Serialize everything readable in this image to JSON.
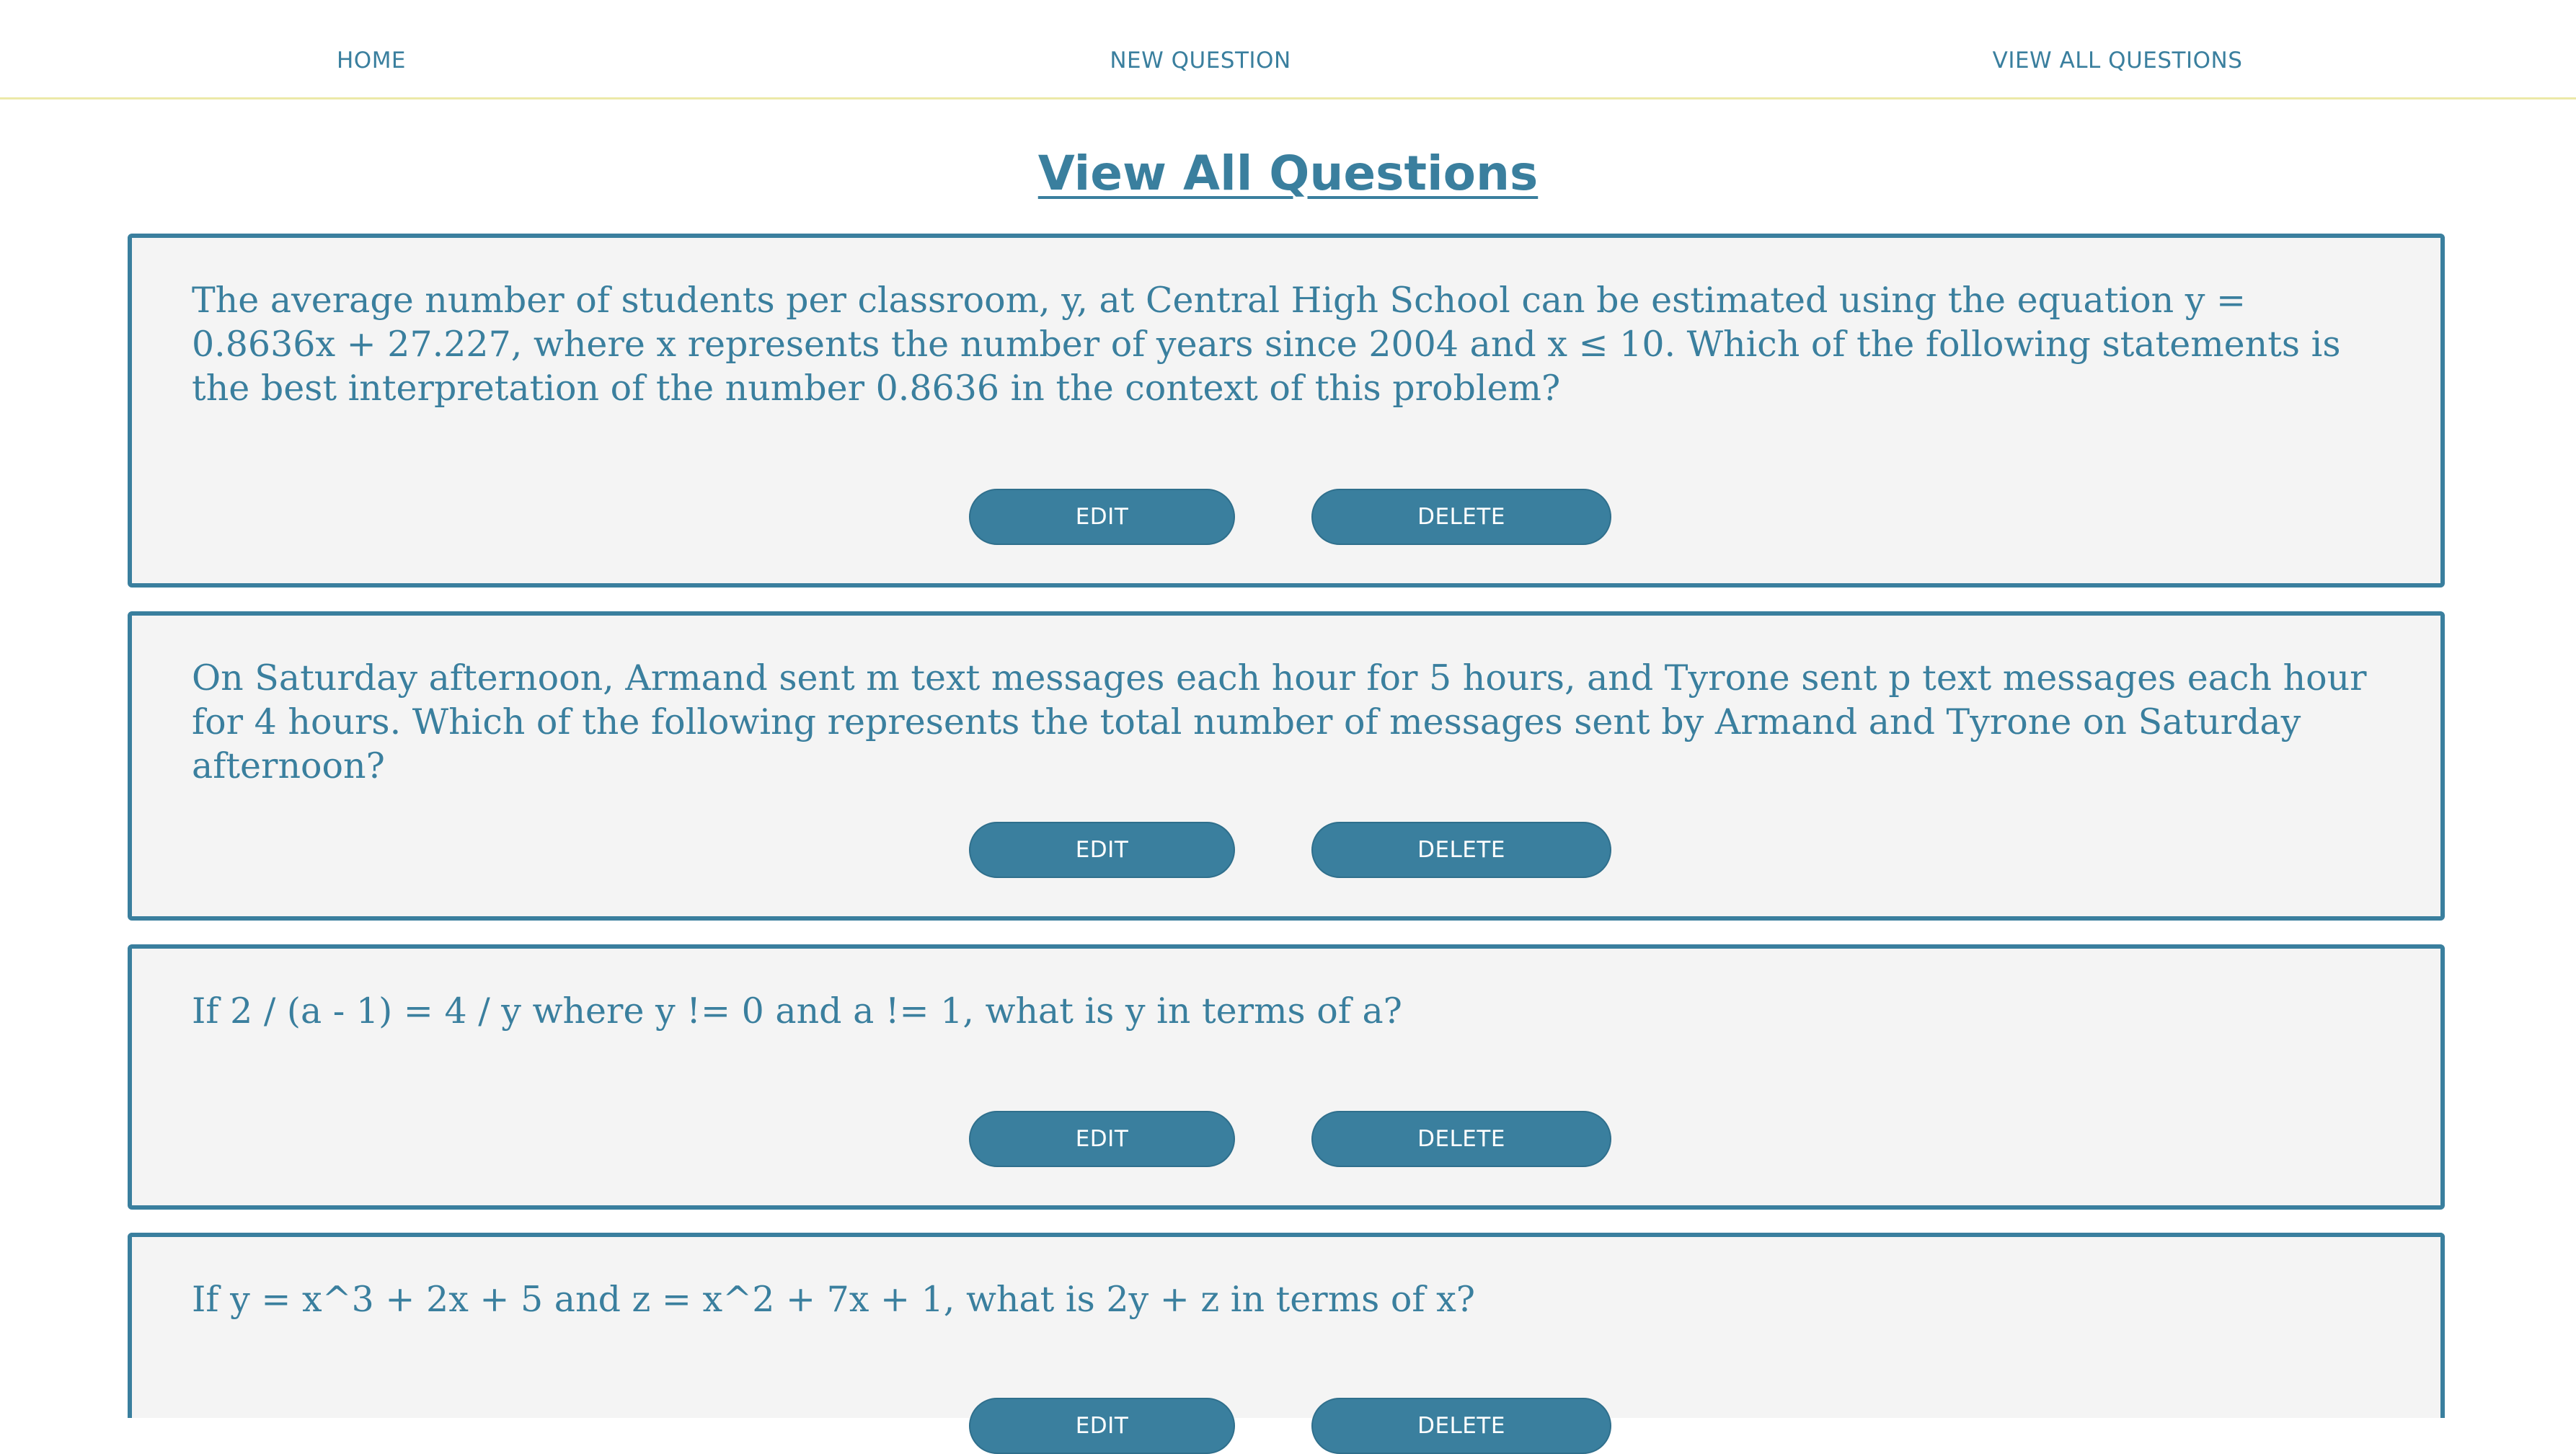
{
  "nav": {
    "home": "HOME",
    "new_question": "NEW QUESTION",
    "view_all": "VIEW ALL QUESTIONS"
  },
  "page": {
    "title": "View All Questions"
  },
  "questions": [
    {
      "text": "The average number of students per classroom, y, at Central High School can be estimated using the equation y = 0.8636x + 27.227, where x represents the number of years since 2004 and x ≤ 10. Which of the following statements is the best interpretation of the number 0.8636 in the context of this problem?",
      "edit_label": "EDIT",
      "delete_label": "DELETE"
    },
    {
      "text": "On Saturday afternoon, Armand sent m text messages each hour for 5 hours, and Tyrone sent p text messages each hour for 4 hours. Which of the following represents the total number of messages sent by Armand and Tyrone on Saturday afternoon?",
      "edit_label": "EDIT",
      "delete_label": "DELETE"
    },
    {
      "text": "If 2 / (a - 1) = 4 / y where y != 0 and a != 1, what is y in terms of a?",
      "edit_label": "EDIT",
      "delete_label": "DELETE"
    },
    {
      "text": "If y = x^3 + 2x + 5 and z = x^2 + 7x + 1, what is 2y + z in terms of x?",
      "edit_label": "EDIT",
      "delete_label": "DELETE"
    }
  ],
  "colors": {
    "accent": "#3a7f9e",
    "card_background": "#f4f4f4",
    "nav_border": "#ece9a8"
  }
}
